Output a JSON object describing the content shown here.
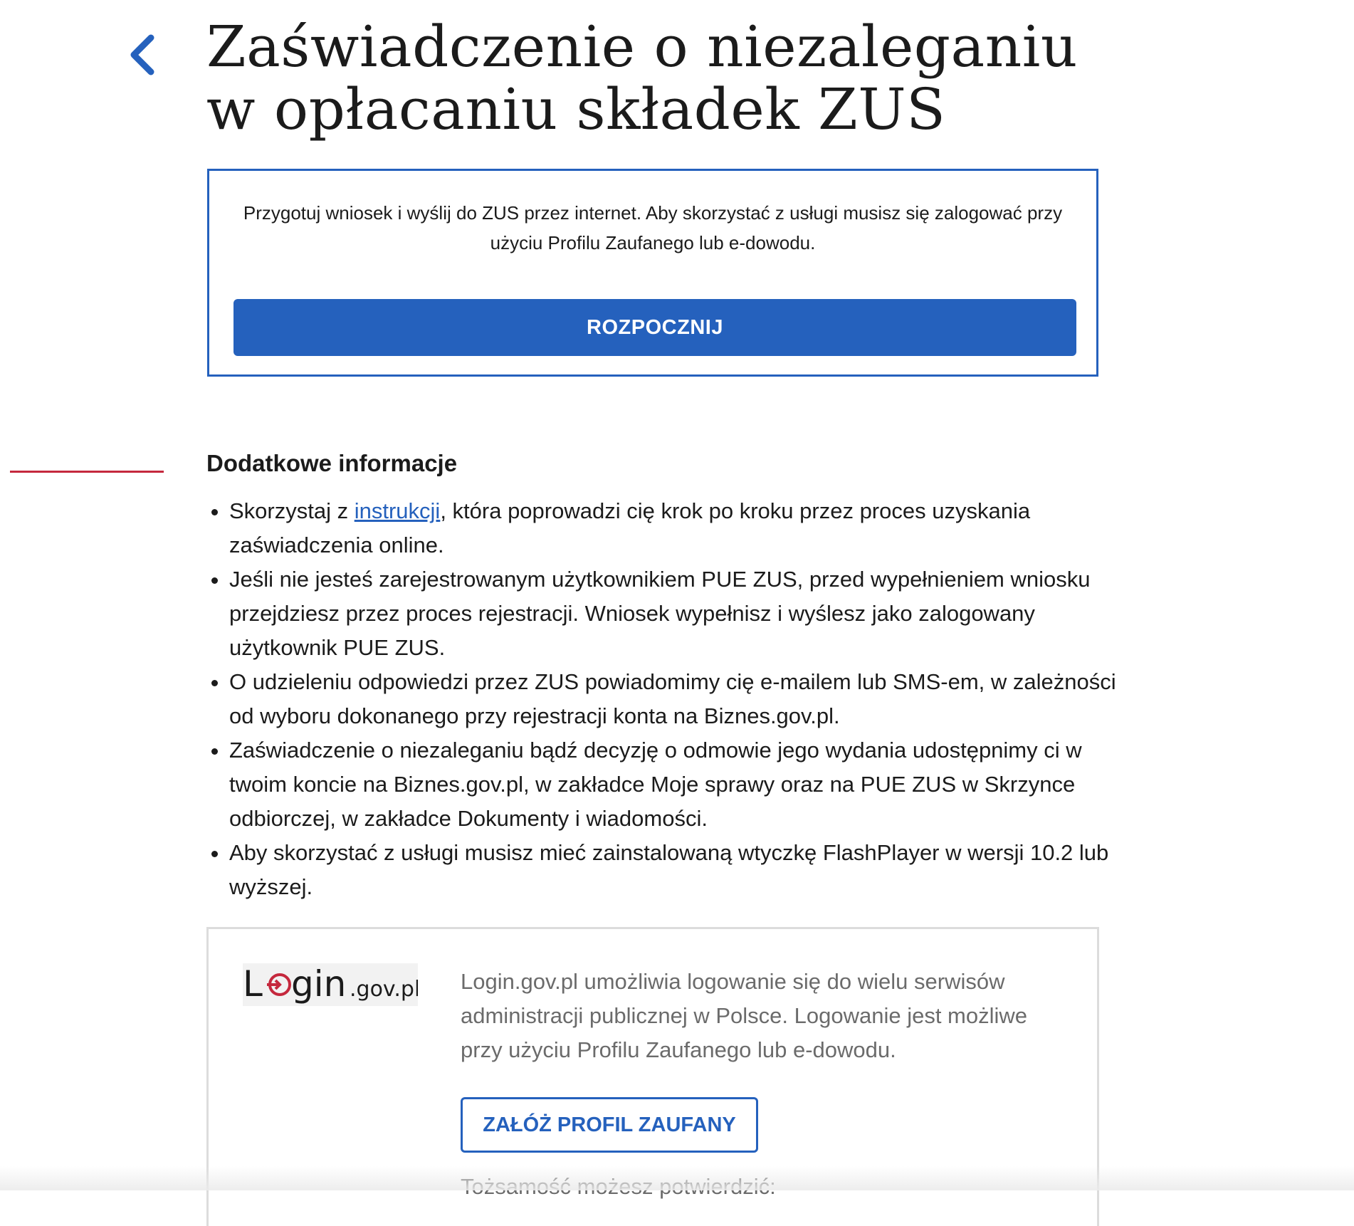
{
  "page": {
    "title": "Zaświadczenie o niezaleganiu w opłacaniu składek ZUS",
    "back_icon": "chevron-left-icon"
  },
  "start_box": {
    "description": "Przygotuj wniosek i wyślij do ZUS przez internet. Aby skorzystać z usługi musisz się zalogować przy użyciu Profilu Zaufanego lub e-dowodu.",
    "button_label": "ROZPOCZNIJ"
  },
  "info": {
    "heading": "Dodatkowe informacje",
    "items": [
      {
        "before_link": "Skorzystaj z ",
        "link_text": "instrukcji",
        "after_link": ", która poprowadzi cię krok po kroku przez proces uzyskania zaświadczenia online."
      },
      {
        "text": "Jeśli nie jesteś zarejestrowanym użytkownikiem PUE ZUS, przed wypełnieniem wniosku przejdziesz przez proces rejestracji. Wniosek wypełnisz i wyślesz jako zalogowany użytkownik PUE ZUS."
      },
      {
        "text": "O udzieleniu odpowiedzi przez ZUS powiadomimy cię e-mailem lub SMS-em, w zależności od wyboru dokonanego przy rejestracji konta na Biznes.gov.pl."
      },
      {
        "text": "Zaświadczenie o niezaleganiu bądź decyzję o odmowie jego wydania udostępnimy ci w twoim koncie na Biznes.gov.pl, w zakładce Moje sprawy oraz na PUE ZUS w Skrzynce odbiorczej, w zakładce Dokumenty i wiadomości."
      },
      {
        "text": "Aby skorzystać z usługi musisz mieć zainstalowaną wtyczkę FlashPlayer w wersji 10.2 lub wyższej."
      }
    ]
  },
  "login_panel": {
    "logo_text": "Login.gov.pl",
    "logo_main": "Login",
    "logo_suffix": ".gov.pl",
    "description": "Login.gov.pl umożliwia logowanie się do wielu serwisów administracji publicznej w Polsce. Logowanie jest możliwe przy użyciu Profilu Zaufanego lub e-dowodu.",
    "button_label": "ZAŁÓŻ PROFIL ZAUFANY",
    "identity_text": "Tożsamość możesz potwierdzić:"
  },
  "colors": {
    "accent_blue": "#2561bd",
    "accent_red": "#c5283d",
    "text_dark": "#1b1b1b",
    "text_muted": "#6b6b6b",
    "border_grey": "#dcdcdc"
  }
}
